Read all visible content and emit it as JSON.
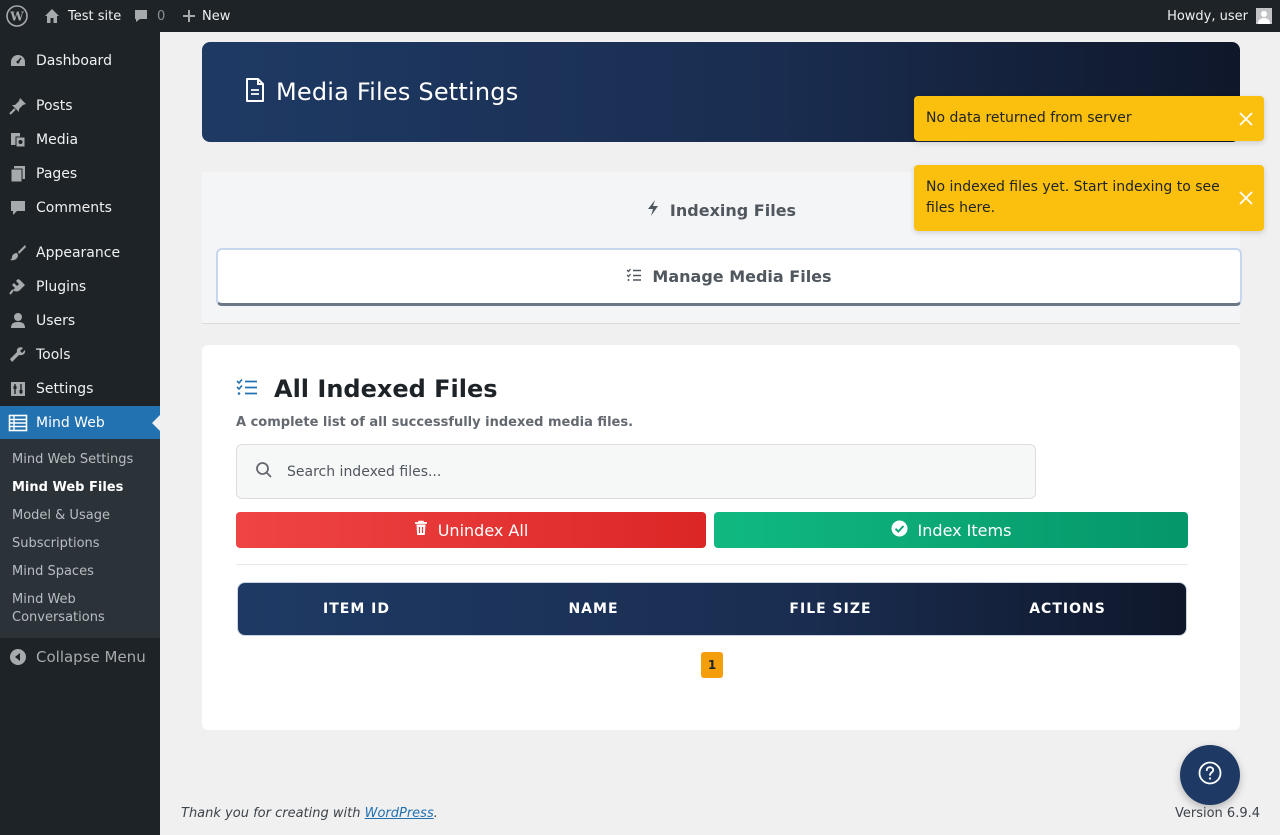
{
  "admin_bar": {
    "site_name": "Test site",
    "comments_count": "0",
    "new_label": "New",
    "howdy": "Howdy, user"
  },
  "sidebar": {
    "items": [
      {
        "label": "Dashboard",
        "icon": "dashboard-icon"
      },
      {
        "label": "Posts",
        "icon": "pin-icon"
      },
      {
        "label": "Media",
        "icon": "media-icon"
      },
      {
        "label": "Pages",
        "icon": "pages-icon"
      },
      {
        "label": "Comments",
        "icon": "comment-icon"
      },
      {
        "label": "Appearance",
        "icon": "brush-icon"
      },
      {
        "label": "Plugins",
        "icon": "plug-icon"
      },
      {
        "label": "Users",
        "icon": "user-icon"
      },
      {
        "label": "Tools",
        "icon": "wrench-icon"
      },
      {
        "label": "Settings",
        "icon": "settings-icon"
      },
      {
        "label": "Mind Web",
        "icon": "table-icon"
      }
    ],
    "submenu": [
      "Mind Web Settings",
      "Mind Web Files",
      "Model & Usage",
      "Subscriptions",
      "Mind Spaces",
      "Mind Web Conversations"
    ],
    "collapse_label": "Collapse Menu"
  },
  "header": {
    "title": "Media Files Settings"
  },
  "tabs": {
    "indexing": "Indexing Files",
    "manage": "Manage Media Files"
  },
  "card": {
    "title": "All Indexed Files",
    "description": "A complete list of all successfully indexed media files.",
    "search_placeholder": "Search indexed files...",
    "unindex_label": "Unindex All",
    "index_label": "Index Items",
    "columns": [
      "ITEM ID",
      "NAME",
      "FILE SIZE",
      "ACTIONS"
    ],
    "page": "1"
  },
  "toasts": [
    "No data returned from server",
    "No indexed files yet. Start indexing to see files here."
  ],
  "footer": {
    "thanks_prefix": "Thank you for creating with",
    "wordpress_link": "WordPress",
    "thanks_suffix": ".",
    "version": "Version 6.9.4"
  },
  "colors": {
    "admin_dark": "#1d2327",
    "wp_blue": "#2271b1",
    "banner_navy": "#1e3a64",
    "danger": "#ef4444",
    "success": "#10b981",
    "warning": "#fbbf0e",
    "page_accent": "#f59e0b"
  }
}
